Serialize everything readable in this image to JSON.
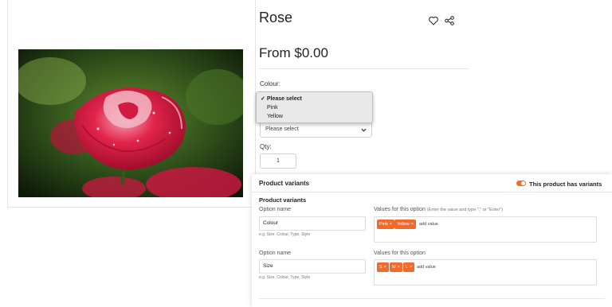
{
  "product": {
    "title": "Rose",
    "price": "From $0.00",
    "colour_label": "Colour:",
    "colour_options": [
      "Please select",
      "Pink",
      "Yellow"
    ],
    "selected_check": "✓",
    "second_select_value": "Please select",
    "qty_label": "Qty:",
    "qty_value": "1",
    "image_alt": "red-rose-photo",
    "icons": {
      "wishlist": "heart-icon",
      "share": "share-icon",
      "select": "chevron-down-icon"
    }
  },
  "variants": {
    "panel_title": "Product variants",
    "toggle_label": "This product has variants",
    "section_title": "Product variants",
    "option_name_label": "Option name",
    "values_label": "Values for this option",
    "values_hint": "(Enter the value and type \",\" or \"Enter\")",
    "option_help": "e.g. Size, Colour, Type, Style",
    "add_value_text": "add value",
    "remove_mark": "×",
    "options": [
      {
        "name": "Colour",
        "values": [
          "Pink",
          "Yellow"
        ]
      },
      {
        "name": "Size",
        "values": [
          "S",
          "M",
          "L"
        ]
      }
    ],
    "accent_color": "#f26a2b"
  }
}
